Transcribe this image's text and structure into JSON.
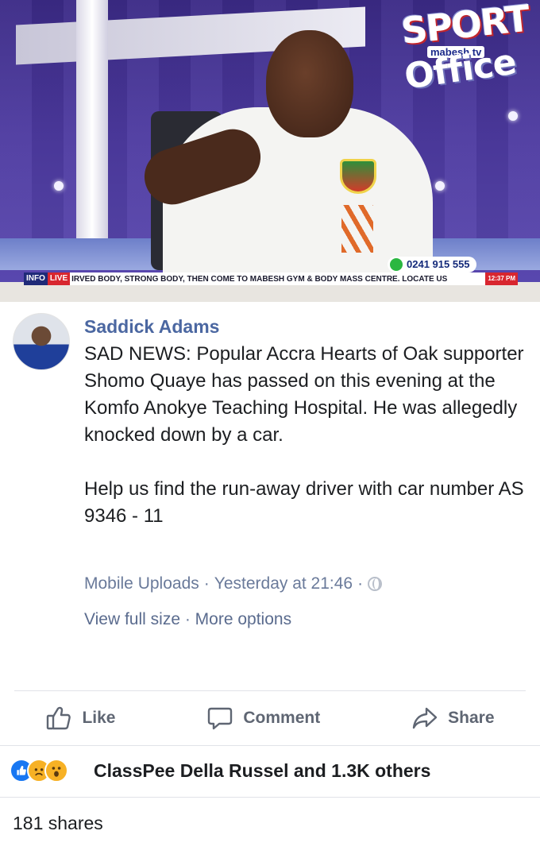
{
  "photo": {
    "logo_top": "SPORT",
    "logo_bottom": "Office",
    "channel": "mabesh tv",
    "phone": "0241 915 555",
    "ticker_info": "INFO",
    "ticker_live": "LIVE",
    "ticker_text": "IRVED BODY, STRONG BODY, THEN COME TO MABESH GYM & BODY MASS CENTRE. LOCATE US",
    "ticker_time": "12:37 PM"
  },
  "post": {
    "author": "Saddick Adams",
    "paragraphs": [
      "SAD NEWS: Popular Accra Hearts of Oak supporter Shomo Quaye has passed on this evening at the Komfo Anokye Teaching Hospital. He was allegedly knocked down by a car.",
      "Help us find the run-away driver with car number AS 9346 - 11"
    ],
    "album": "Mobile Uploads",
    "separator": " · ",
    "time": "Yesterday at 21:46",
    "privacy_icon": "globe-icon",
    "view_full_size": "View full size",
    "more_options": "More options"
  },
  "actions": {
    "like": "Like",
    "comment": "Comment",
    "share": "Share"
  },
  "reactions": {
    "icons": [
      "like-reaction-icon",
      "sad-reaction-icon",
      "wow-reaction-icon"
    ],
    "summary": "ClassPee Della Russel and 1.3K others",
    "shares": "181 shares"
  },
  "colors": {
    "author_blue": "#4b67a1",
    "meta_gray": "#6a7a9a",
    "action_gray": "#5f6673",
    "like_blue": "#1877f2",
    "emoji_yellow": "#f7b125"
  }
}
